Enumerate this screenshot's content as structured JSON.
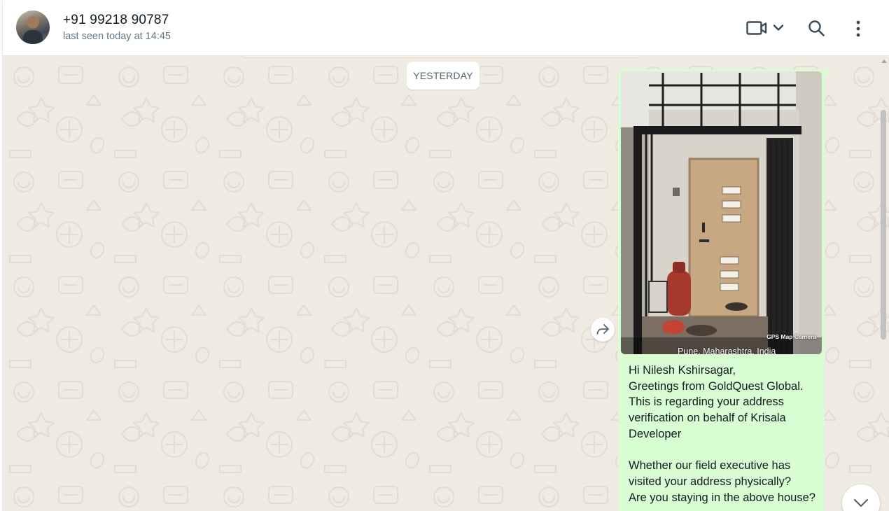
{
  "header": {
    "contact_name": "+91 99218 90787",
    "status": "last seen today at 14:45",
    "icons": [
      "video-call-icon",
      "chevron-down-icon",
      "search-icon",
      "menu-icon"
    ]
  },
  "chat": {
    "date_chip": "YESTERDAY",
    "message": {
      "photo_caption": "Pune, Maharashtra, India",
      "photo_stamp": "GPS Map Camera",
      "text": "Hi Nilesh Kshirsagar,\nGreetings from GoldQuest Global.\nThis is regarding your address verification on behalf of Krisala Developer\n\nWhether our field executive has visited your address physically?\nAre you staying in the above house?"
    }
  },
  "colors": {
    "chat_background": "#efeae2",
    "outgoing_bubble": "#d9fdd3",
    "icon": "#3b4a54",
    "secondary_text": "#667781"
  }
}
